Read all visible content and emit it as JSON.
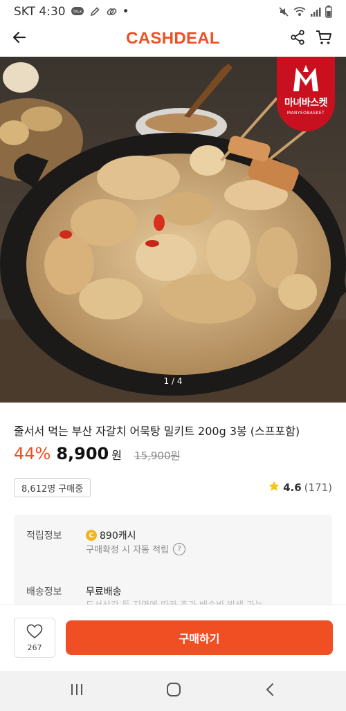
{
  "status_bar": {
    "carrier_time": "SKT 4:30",
    "talk_badge": "TALK",
    "dot": "•",
    "icons": [
      "talk-icon",
      "edit-icon",
      "link-icon",
      "mute-icon",
      "wifi-icon",
      "signal-icon",
      "battery-icon"
    ]
  },
  "header": {
    "brand": "CASHDEAL",
    "brand_color": "#f04e23"
  },
  "hero": {
    "counter": "1 / 4",
    "badge_text": "마녀바스켓",
    "badge_sub": "MANYEOBASKET",
    "badge_color": "#c8101e"
  },
  "product": {
    "title": "줄서서 먹는 부산 자갈치 어묵탕 밀키트 200g 3봉 (스프포함)",
    "discount": "44%",
    "price": "8,900",
    "currency": "원",
    "original_price": "15,900원",
    "buyers": "8,612명 구매중",
    "rating": "4.6",
    "review_count": "(171)"
  },
  "info": {
    "points_label": "적립정보",
    "points_coin": "C",
    "points_value": "890캐시",
    "points_sub": "구매확정 시 자동 적립",
    "help_glyph": "?",
    "shipping_label": "배송정보",
    "shipping_value": "무료배송",
    "shipping_sub": "도서산간 등 지역에 따라 추가 배송비 발생 가능"
  },
  "bottom": {
    "wish_count": "267",
    "buy_label": "구매하기",
    "accent": "#f04e23"
  },
  "nav": {
    "icons": [
      "recent-apps-icon",
      "home-icon",
      "back-nav-icon"
    ]
  }
}
